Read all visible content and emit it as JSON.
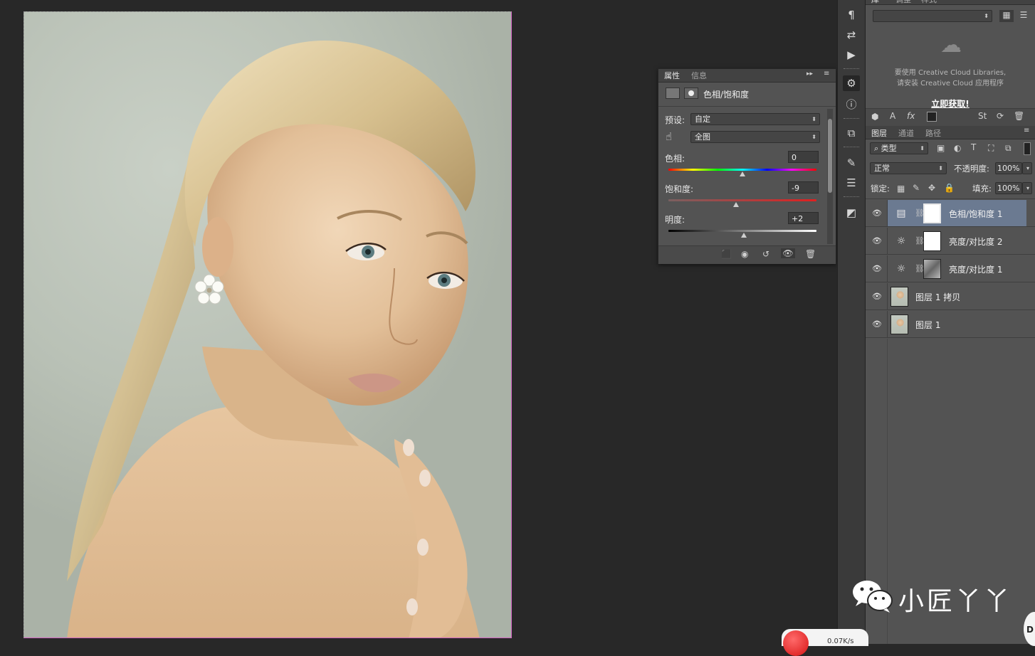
{
  "properties": {
    "tabs": [
      {
        "label": "属性"
      },
      {
        "label": "信息"
      }
    ],
    "adjustment_title": "色相/饱和度",
    "preset_label": "预设:",
    "preset_value": "自定",
    "channel_value": "全图",
    "hue": {
      "label": "色相:",
      "value": "0",
      "level": 0.5
    },
    "saturation": {
      "label": "饱和度:",
      "value": "-9",
      "level": 0.455
    },
    "lightness": {
      "label": "明度:",
      "value": "+2",
      "level": 0.51
    }
  },
  "library": {
    "tabs": [
      {
        "label": "库"
      },
      {
        "label": "调整"
      },
      {
        "label": "样式"
      }
    ],
    "message_line1": "要使用 Creative Cloud Libraries,",
    "message_line2": "请安装 Creative Cloud 应用程序",
    "get_link": "立即获取!"
  },
  "layers_panel": {
    "tabs": [
      {
        "label": "图层"
      },
      {
        "label": "通道"
      },
      {
        "label": "路径"
      }
    ],
    "filter_value": "类型",
    "blend_mode": "正常",
    "opacity_label": "不透明度:",
    "opacity_value": "100%",
    "lock_label": "锁定:",
    "fill_label": "填充:",
    "fill_value": "100%",
    "layers": [
      {
        "name": "色相/饱和度 1"
      },
      {
        "name": "亮度/对比度 2"
      },
      {
        "name": "亮度/对比度 1"
      },
      {
        "name": "图层 1 拷贝"
      },
      {
        "name": "图层 1"
      }
    ]
  },
  "watermark": {
    "text": "小匠丫丫"
  },
  "net_speed": {
    "text": "0.07K/s"
  },
  "colors": {
    "selected_row": "#6b7a91",
    "canvas_border": "#d060c0",
    "panel_bg": "#535353"
  }
}
